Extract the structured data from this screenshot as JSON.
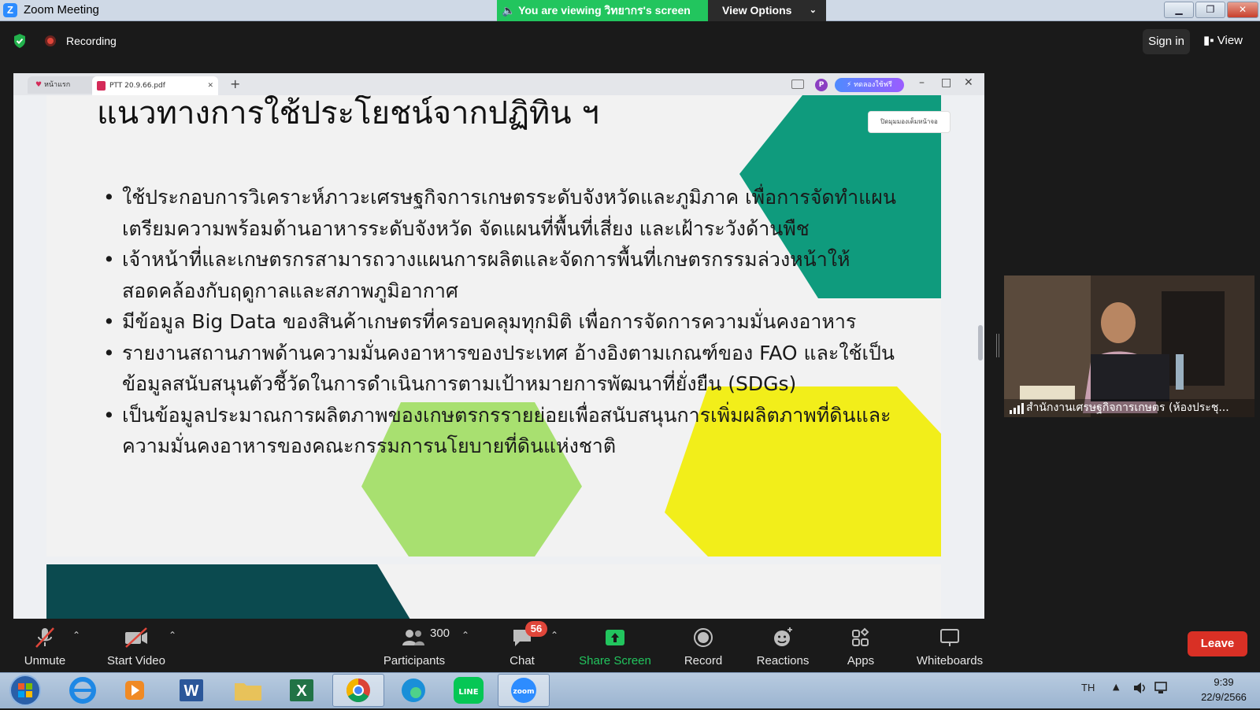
{
  "window": {
    "title": "Zoom Meeting",
    "viewing_banner": "You are viewing วิทยากร's screen",
    "view_options": "View Options"
  },
  "topbar": {
    "recording_label": "Recording",
    "signin_label": "Sign in",
    "view_label": "View"
  },
  "browser": {
    "tab_home": "หน้าแรก",
    "tab_pdf": "PTT 20.9.66.pdf",
    "profile_initial": "P",
    "ai_button": "ทดลองใช้ฟรี",
    "close_panel": "ปิดมุมมองเต็มหน้าจอ"
  },
  "slide": {
    "title": "แนวทางการใช้ประโยชน์จากปฏิทิน ฯ",
    "bullets": [
      "ใช้ประกอบการวิเคราะห์ภาวะเศรษฐกิจการเกษตรระดับจังหวัดและภูมิภาค เพื่อการจัดทำแผนเตรียมความพร้อมด้านอาหารระดับจังหวัด จัดแผนที่พื้นที่เสี่ยง และเฝ้าระวังด้านพืช",
      "เจ้าหน้าที่และเกษตรกรสามารถวางแผนการผลิตและจัดการพื้นที่เกษตรกรรมล่วงหน้าให้สอดคล้องกับฤดูกาลและสภาพภูมิอากาศ",
      "มีข้อมูล Big Data ของสินค้าเกษตรที่ครอบคลุมทุกมิติ เพื่อการจัดการความมั่นคงอาหาร",
      "รายงานสถานภาพด้านความมั่นคงอาหารของประเทศ อ้างอิงตามเกณฑ์ของ FAO และใช้เป็นข้อมูลสนับสนุนตัวชี้วัดในการดำเนินการตามเป้าหมายการพัฒนาที่ยั่งยืน (SDGs)",
      "เป็นข้อมูลประมาณการผลิตภาพของเกษตรกรรายย่อยเพื่อสนับสนุนการเพิ่มผลิตภาพที่ดินและความมั่นคงอาหารของคณะกรรมการนโยบายที่ดินแห่งชาติ"
    ],
    "colors": {
      "teal": "#0f9b7d",
      "lime": "#a8e070",
      "yellow": "#f2ee1a",
      "dark_teal": "#0b4a4f"
    }
  },
  "video": {
    "participant_name": "สำนักงานเศรษฐกิจการเกษตร (ห้องประชุ..."
  },
  "toolbar": {
    "unmute": "Unmute",
    "start_video": "Start Video",
    "participants": "Participants",
    "participant_count": "300",
    "chat": "Chat",
    "chat_badge": "56",
    "share_screen": "Share Screen",
    "record": "Record",
    "reactions": "Reactions",
    "apps": "Apps",
    "whiteboards": "Whiteboards",
    "leave": "Leave"
  },
  "taskbar": {
    "language": "TH",
    "time": "9:39",
    "date": "22/9/2566"
  },
  "accent_colors": {
    "share_green": "#22c55e",
    "leave_red": "#d93025",
    "zoom_blue": "#2d8cff"
  }
}
